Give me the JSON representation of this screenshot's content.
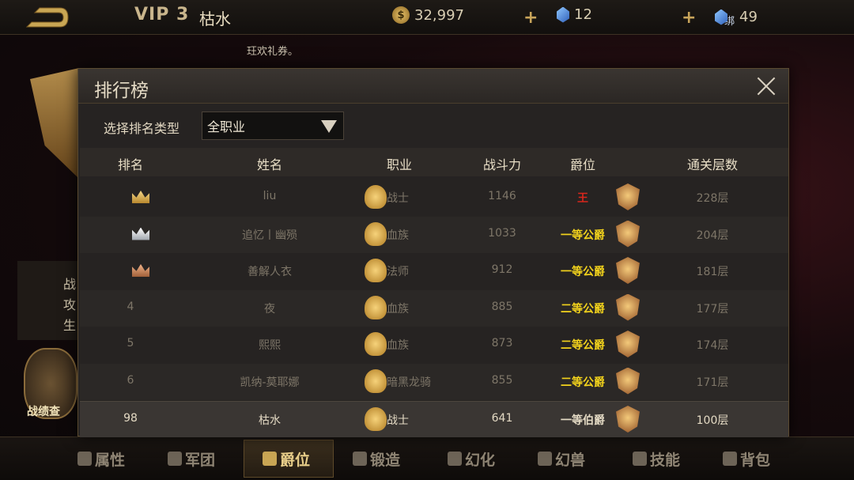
{
  "topbar": {
    "vip_label": "VIP 3",
    "player_name": "枯水",
    "gold": "32,997",
    "gold_symbol": "$",
    "gems": "12",
    "bound_gems": "49",
    "bound_tag": "绑"
  },
  "ticker": "玨欢礼券。",
  "left_panel": {
    "lines": [
      "战",
      "攻",
      "生"
    ],
    "medal_label": "战绩查"
  },
  "modal": {
    "title": "排行榜",
    "filter_label": "选择排名类型",
    "filter_value": "全职业",
    "columns": [
      "排名",
      "姓名",
      "职业",
      "战斗力",
      "爵位",
      "通关层数"
    ],
    "rows": [
      {
        "rank": "",
        "crown": "gold",
        "name": "liu",
        "class": "战士",
        "power": "1146",
        "title": "王",
        "title_color": "#d8261c",
        "floors": "228层"
      },
      {
        "rank": "",
        "crown": "silver",
        "name": "追忆丨幽殒",
        "class": "血族",
        "power": "1033",
        "title": "一等公爵",
        "title_color": "#f2d21c",
        "floors": "204层"
      },
      {
        "rank": "",
        "crown": "bronze",
        "name": "善解人衣",
        "class": "法师",
        "power": "912",
        "title": "一等公爵",
        "title_color": "#f2d21c",
        "floors": "181层"
      },
      {
        "rank": "4",
        "crown": "",
        "name": "夜",
        "class": "血族",
        "power": "885",
        "title": "二等公爵",
        "title_color": "#f2d21c",
        "floors": "177层"
      },
      {
        "rank": "5",
        "crown": "",
        "name": "熙熙",
        "class": "血族",
        "power": "873",
        "title": "二等公爵",
        "title_color": "#f2d21c",
        "floors": "174层"
      },
      {
        "rank": "6",
        "crown": "",
        "name": "凯纳-莫耶娜",
        "class": "暗黑龙骑",
        "power": "855",
        "title": "二等公爵",
        "title_color": "#f2d21c",
        "floors": "171层"
      }
    ],
    "self_row": {
      "rank": "98",
      "name": "枯水",
      "class": "战士",
      "power": "641",
      "title": "一等伯爵",
      "title_color": "#e4dac4",
      "floors": "100层"
    }
  },
  "tabs": [
    {
      "label": "属性",
      "icon": "attribute-icon",
      "active": false
    },
    {
      "label": "军团",
      "icon": "legion-icon",
      "active": false
    },
    {
      "label": "爵位",
      "icon": "crown-icon",
      "active": true
    },
    {
      "label": "锻造",
      "icon": "forge-icon",
      "active": false
    },
    {
      "label": "幻化",
      "icon": "transform-icon",
      "active": false
    },
    {
      "label": "幻兽",
      "icon": "beast-icon",
      "active": false
    },
    {
      "label": "技能",
      "icon": "skill-icon",
      "active": false
    },
    {
      "label": "背包",
      "icon": "bag-icon",
      "active": false
    }
  ],
  "colors": {
    "accent_gold": "#e9cf8a",
    "king_red": "#d8261c",
    "duke_yellow": "#f2d21c"
  }
}
